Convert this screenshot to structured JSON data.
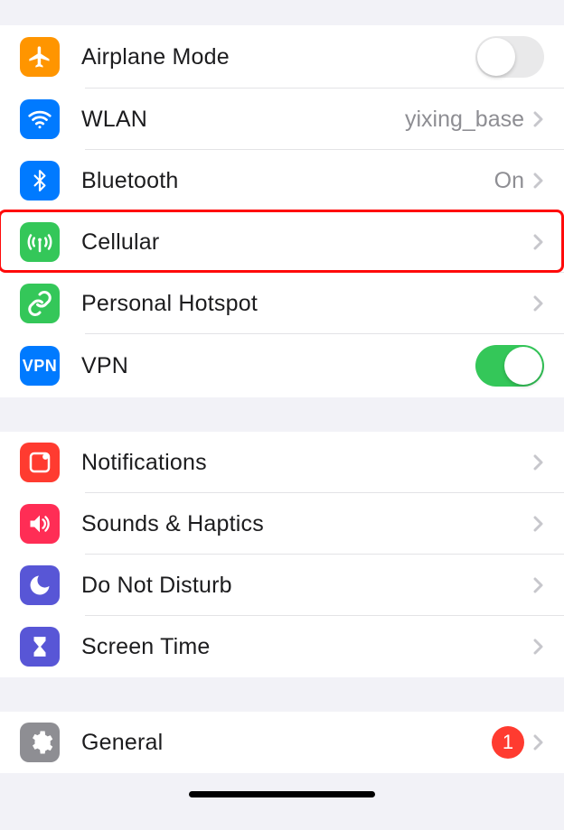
{
  "groups": [
    {
      "id": "connectivity",
      "rows": [
        {
          "id": "airplane-mode",
          "icon": "airplane",
          "iconBg": "#ff9500",
          "label": "Airplane Mode",
          "control": "toggle",
          "toggleState": "off"
        },
        {
          "id": "wlan",
          "icon": "wifi",
          "iconBg": "#007aff",
          "label": "WLAN",
          "value": "yixing_base",
          "control": "disclosure"
        },
        {
          "id": "bluetooth",
          "icon": "bluetooth",
          "iconBg": "#007aff",
          "label": "Bluetooth",
          "value": "On",
          "control": "disclosure"
        },
        {
          "id": "cellular",
          "icon": "antenna",
          "iconBg": "#34c759",
          "label": "Cellular",
          "control": "disclosure",
          "highlighted": true
        },
        {
          "id": "hotspot",
          "icon": "link",
          "iconBg": "#34c759",
          "label": "Personal Hotspot",
          "control": "disclosure"
        },
        {
          "id": "vpn",
          "icon": "vpn-text",
          "iconBg": "#007aff",
          "label": "VPN",
          "control": "toggle",
          "toggleState": "on"
        }
      ]
    },
    {
      "id": "alerts",
      "rows": [
        {
          "id": "notifications",
          "icon": "notification-square",
          "iconBg": "#ff3b30",
          "label": "Notifications",
          "control": "disclosure"
        },
        {
          "id": "sounds",
          "icon": "speaker",
          "iconBg": "#ff2d55",
          "label": "Sounds & Haptics",
          "control": "disclosure"
        },
        {
          "id": "dnd",
          "icon": "moon",
          "iconBg": "#5856d6",
          "label": "Do Not Disturb",
          "control": "disclosure"
        },
        {
          "id": "screentime",
          "icon": "hourglass",
          "iconBg": "#5856d6",
          "label": "Screen Time",
          "control": "disclosure"
        }
      ]
    },
    {
      "id": "general-group",
      "rows": [
        {
          "id": "general",
          "icon": "gear",
          "iconBg": "#8e8e93",
          "label": "General",
          "badge": "1",
          "control": "disclosure"
        }
      ]
    }
  ]
}
